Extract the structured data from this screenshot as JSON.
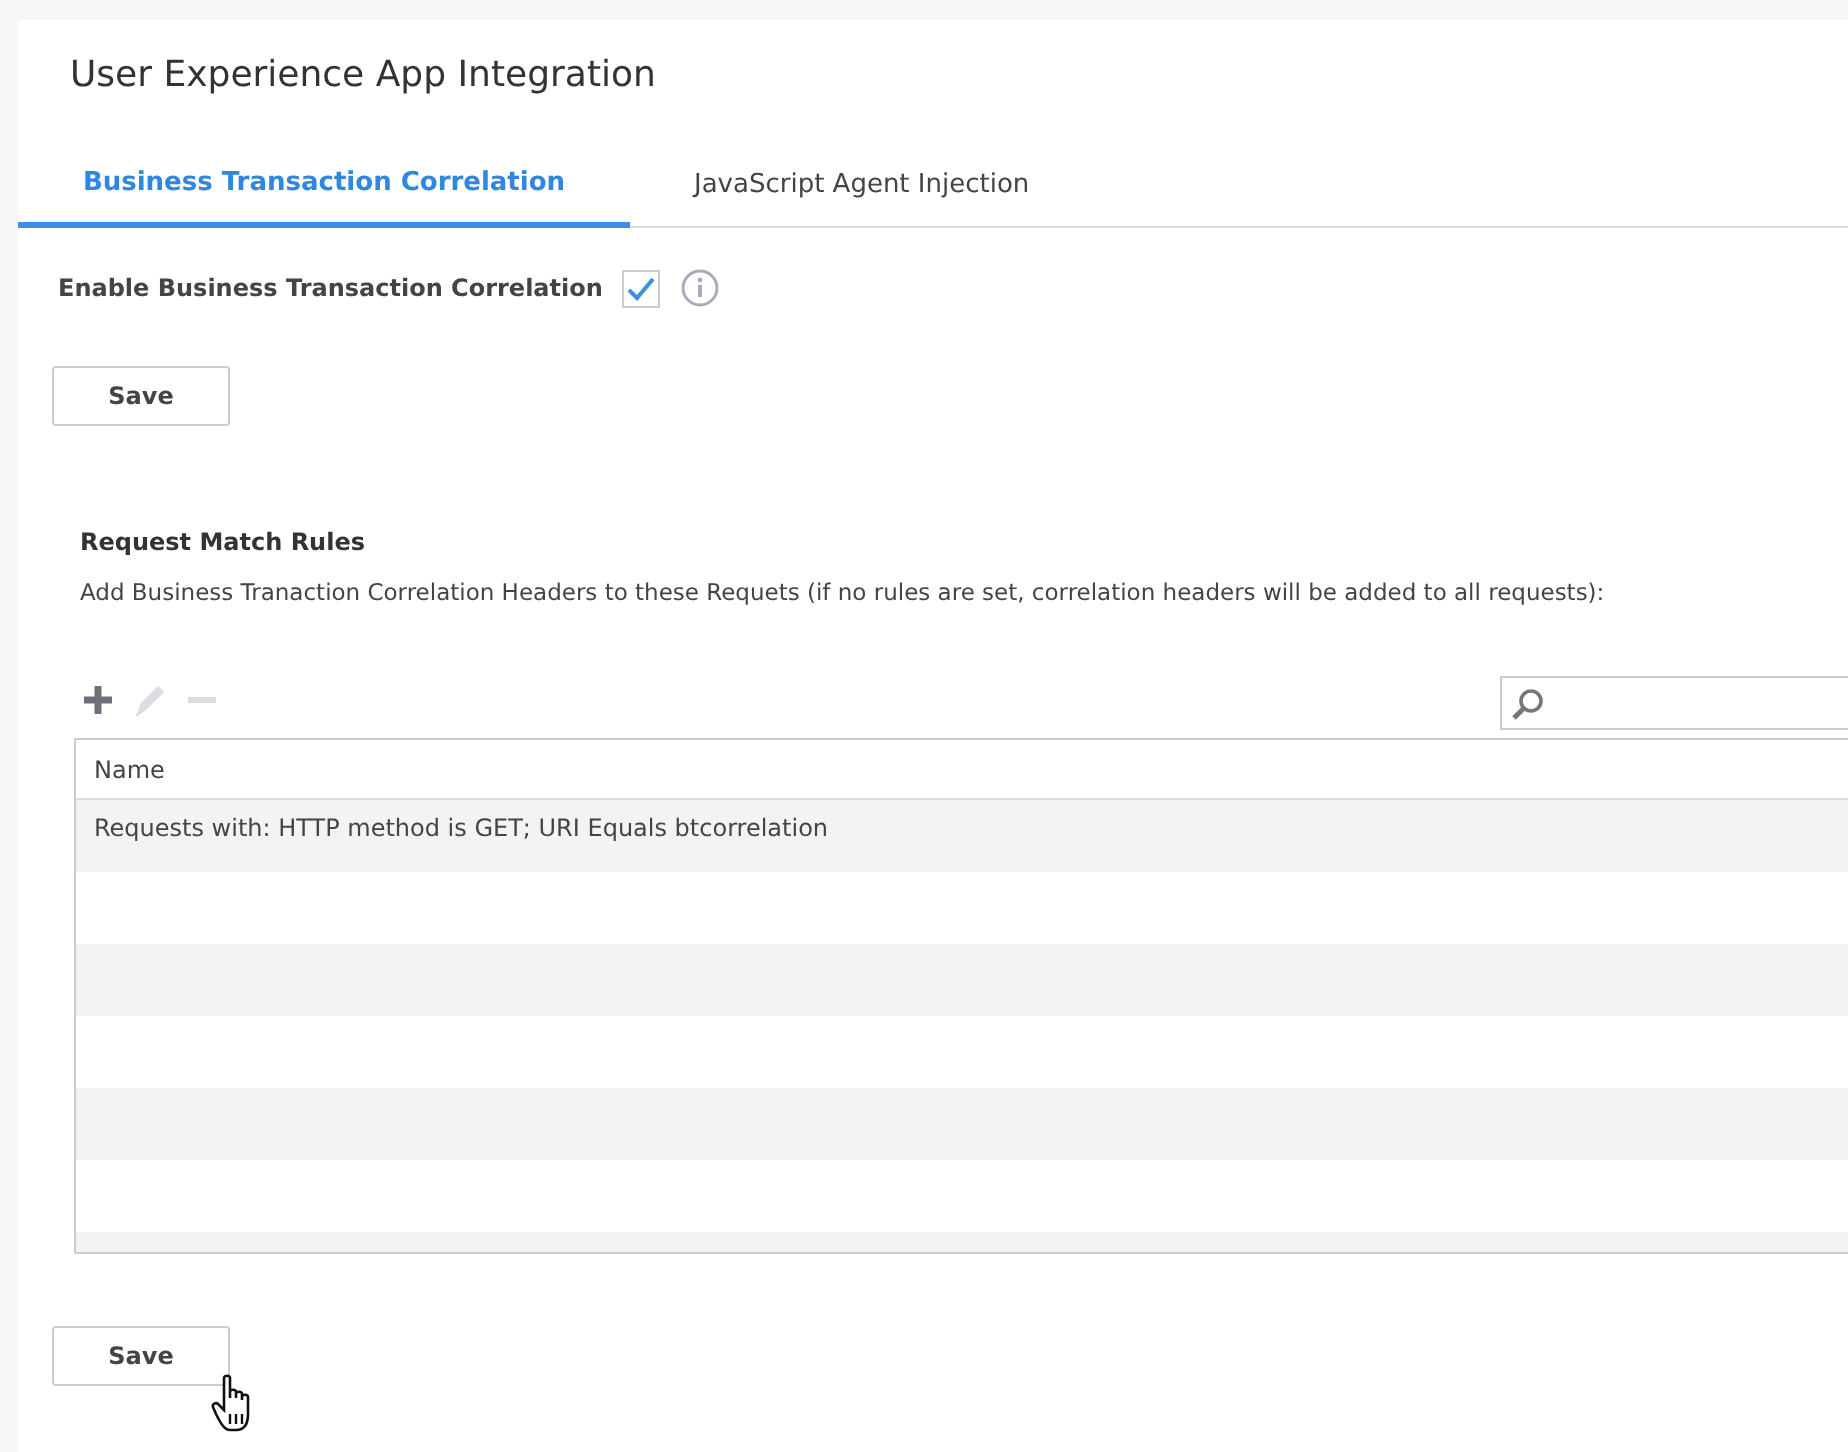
{
  "title": "User Experience App Integration",
  "tabs": [
    {
      "label": "Business Transaction Correlation",
      "selected": true
    },
    {
      "label": "JavaScript Agent Injection",
      "selected": false
    }
  ],
  "enable_option": {
    "label": "Enable Business Transaction Correlation",
    "checked": true
  },
  "save_button_top": "Save",
  "rules": {
    "heading": "Request Match Rules",
    "description": "Add Business Tranaction Correlation Headers to these Requets (if no rules are set, correlation headers will be added to all requests):",
    "toolbar": [
      {
        "kind": "add",
        "disabled": false
      },
      {
        "kind": "edit",
        "disabled": true
      },
      {
        "kind": "remove",
        "disabled": true
      }
    ],
    "columns": [
      "Name"
    ],
    "rows": [
      {
        "name": "Requests with: HTTP method is GET; URI Equals btcorrelation",
        "selected": false
      }
    ]
  },
  "save_button_bottom": "Save"
}
